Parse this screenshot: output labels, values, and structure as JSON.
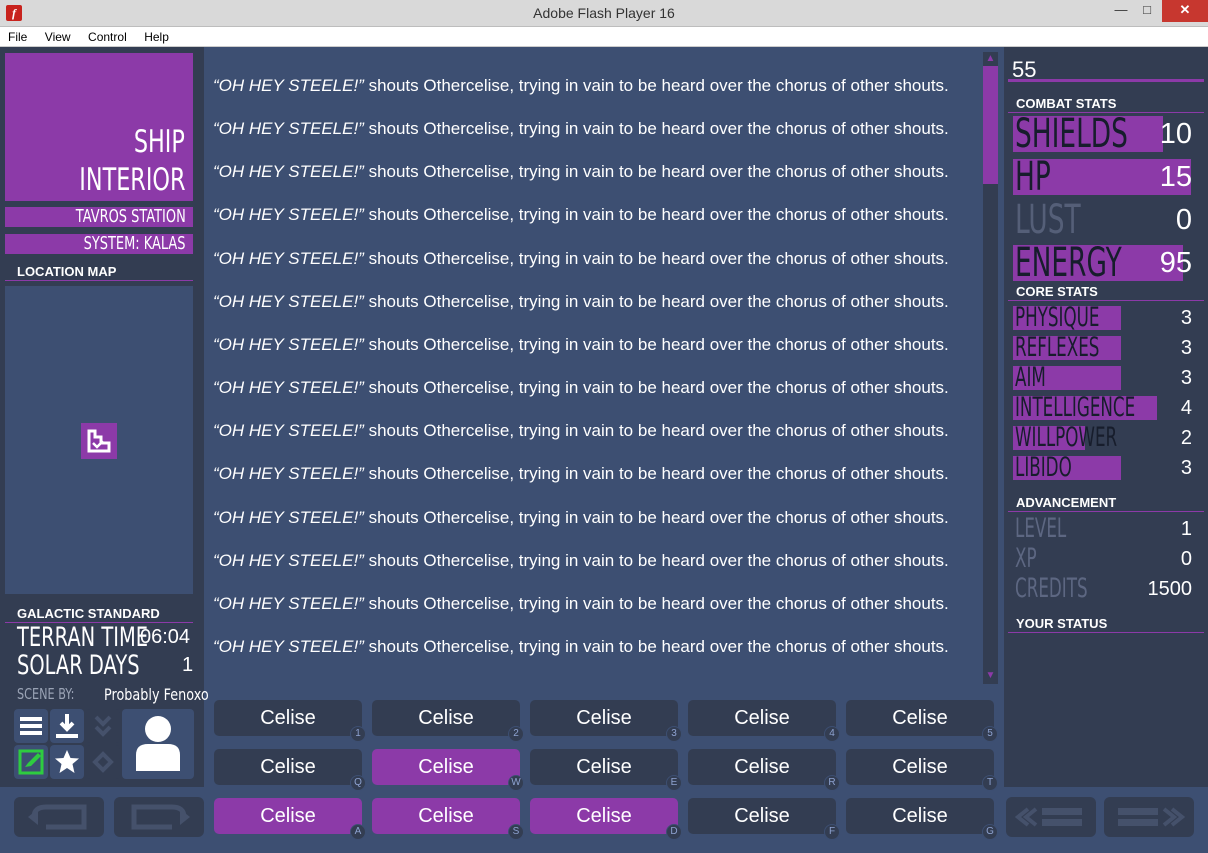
{
  "window": {
    "title": "Adobe Flash Player 16",
    "minimize": "—",
    "maximize": "□",
    "close": "✕",
    "app_icon": "f"
  },
  "menu": {
    "file": "File",
    "view": "View",
    "control": "Control",
    "help": "Help"
  },
  "location": {
    "room_line1": "SHIP",
    "room_line2": "INTERIOR",
    "planet": "TAVROS STATION",
    "system": "SYSTEM: KALAS",
    "map_header": "LOCATION MAP"
  },
  "time": {
    "header": "GALACTIC STANDARD",
    "terran_label": "TERRAN TIME",
    "terran_value": "06:04",
    "solar_label": "SOLAR DAYS",
    "solar_value": "1",
    "scene_by_label": "SCENE BY:",
    "scene_by_value": "Probably Fenoxo"
  },
  "text_lines": [
    {
      "quote": "“OH HEY STEELE!”",
      "rest": " shouts Othercelise, trying in vain to be heard over the chorus of other shouts."
    },
    {
      "quote": "“OH HEY STEELE!”",
      "rest": " shouts Othercelise, trying in vain to be heard over the chorus of other shouts."
    },
    {
      "quote": "“OH HEY STEELE!”",
      "rest": " shouts Othercelise, trying in vain to be heard over the chorus of other shouts."
    },
    {
      "quote": "“OH HEY STEELE!”",
      "rest": " shouts Othercelise, trying in vain to be heard over the chorus of other shouts."
    },
    {
      "quote": "“OH HEY STEELE!”",
      "rest": " shouts Othercelise, trying in vain to be heard over the chorus of other shouts."
    },
    {
      "quote": "“OH HEY STEELE!”",
      "rest": " shouts Othercelise, trying in vain to be heard over the chorus of other shouts."
    },
    {
      "quote": "“OH HEY STEELE!”",
      "rest": " shouts Othercelise, trying in vain to be heard over the chorus of other shouts."
    },
    {
      "quote": "“OH HEY STEELE!”",
      "rest": " shouts Othercelise, trying in vain to be heard over the chorus of other shouts."
    },
    {
      "quote": "“OH HEY STEELE!”",
      "rest": " shouts Othercelise, trying in vain to be heard over the chorus of other shouts."
    },
    {
      "quote": "“OH HEY STEELE!”",
      "rest": " shouts Othercelise, trying in vain to be heard over the chorus of other shouts."
    },
    {
      "quote": "“OH HEY STEELE!”",
      "rest": " shouts Othercelise, trying in vain to be heard over the chorus of other shouts."
    },
    {
      "quote": "“OH HEY STEELE!”",
      "rest": " shouts Othercelise, trying in vain to be heard over the chorus of other shouts."
    },
    {
      "quote": "“OH HEY STEELE!”",
      "rest": " shouts Othercelise, trying in vain to be heard over the chorus of other shouts."
    },
    {
      "quote": "“OH HEY STEELE!”",
      "rest": " shouts Othercelise, trying in vain to be heard over the chorus of other shouts."
    }
  ],
  "scroll": {
    "up": "▲",
    "down": "▼"
  },
  "stats": {
    "days_number": "55",
    "combat_header": "COMBAT STATS",
    "combat": [
      {
        "label": "SHIELDS",
        "value": "10",
        "fill": 1.0
      },
      {
        "label": "HP",
        "value": "15",
        "fill": 1.0
      },
      {
        "label": "LUST",
        "value": "0",
        "fill": 0.0
      },
      {
        "label": "ENERGY",
        "value": "95",
        "fill": 0.95
      }
    ],
    "core_header": "CORE STATS",
    "core": [
      {
        "label": "PHYSIQUE",
        "value": "3"
      },
      {
        "label": "REFLEXES",
        "value": "3"
      },
      {
        "label": "AIM",
        "value": "3"
      },
      {
        "label": "INTELLIGENCE",
        "value": "4"
      },
      {
        "label": "WILLPOWER",
        "value": "2"
      },
      {
        "label": "LIBIDO",
        "value": "3"
      }
    ],
    "advancement_header": "ADVANCEMENT",
    "advancement": [
      {
        "label": "LEVEL",
        "value": "1"
      },
      {
        "label": "XP",
        "value": "0"
      },
      {
        "label": "CREDITS",
        "value": "1500"
      }
    ],
    "status_header": "YOUR STATUS"
  },
  "actions": [
    {
      "label": "Celise",
      "key": "1",
      "active": false
    },
    {
      "label": "Celise",
      "key": "2",
      "active": false
    },
    {
      "label": "Celise",
      "key": "3",
      "active": false
    },
    {
      "label": "Celise",
      "key": "4",
      "active": false
    },
    {
      "label": "Celise",
      "key": "5",
      "active": false
    },
    {
      "label": "Celise",
      "key": "Q",
      "active": false
    },
    {
      "label": "Celise",
      "key": "W",
      "active": true
    },
    {
      "label": "Celise",
      "key": "E",
      "active": false
    },
    {
      "label": "Celise",
      "key": "R",
      "active": false
    },
    {
      "label": "Celise",
      "key": "T",
      "active": false
    },
    {
      "label": "Celise",
      "key": "A",
      "active": true
    },
    {
      "label": "Celise",
      "key": "S",
      "active": true
    },
    {
      "label": "Celise",
      "key": "D",
      "active": true
    },
    {
      "label": "Celise",
      "key": "F",
      "active": false
    },
    {
      "label": "Celise",
      "key": "G",
      "active": false
    }
  ],
  "colors": {
    "accent": "#8c3aa8",
    "panel": "#333d52",
    "background": "#3d4f72"
  },
  "icons": [
    "menu-icon",
    "save-icon",
    "load-icon",
    "appearance-icon",
    "perk-icon",
    "misc-icon",
    "profile-icon",
    "undo-icon",
    "redo-icon",
    "prev-page-icon",
    "next-page-icon",
    "map-player-icon"
  ]
}
